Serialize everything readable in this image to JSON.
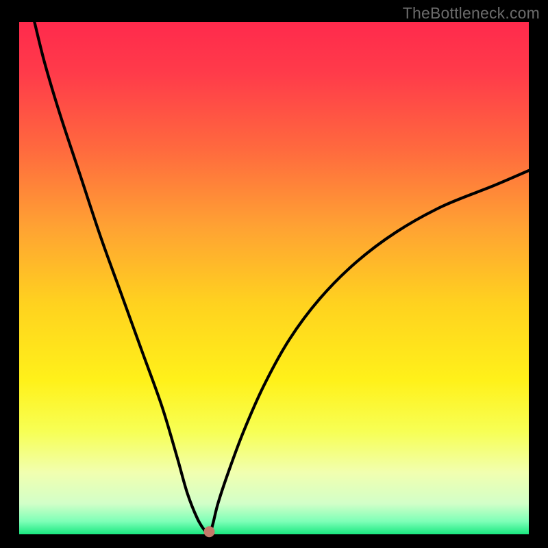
{
  "watermark": "TheBottleneck.com",
  "chart_data": {
    "type": "line",
    "title": "",
    "xlabel": "",
    "ylabel": "",
    "xlim": [
      0,
      100
    ],
    "ylim": [
      0,
      100
    ],
    "gradient_stops": [
      {
        "offset": 0.0,
        "color": "#ff2a4c"
      },
      {
        "offset": 0.1,
        "color": "#ff3b4a"
      },
      {
        "offset": 0.25,
        "color": "#ff6a3e"
      },
      {
        "offset": 0.4,
        "color": "#ffa233"
      },
      {
        "offset": 0.55,
        "color": "#ffd21f"
      },
      {
        "offset": 0.7,
        "color": "#fff11a"
      },
      {
        "offset": 0.8,
        "color": "#f7ff55"
      },
      {
        "offset": 0.88,
        "color": "#f1ffb0"
      },
      {
        "offset": 0.94,
        "color": "#d2ffc8"
      },
      {
        "offset": 0.975,
        "color": "#7dffb7"
      },
      {
        "offset": 1.0,
        "color": "#19e87f"
      }
    ],
    "series": [
      {
        "name": "bottleneck-curve",
        "x": [
          3,
          5,
          8,
          12,
          16,
          20,
          24,
          28,
          31,
          33,
          35,
          36.5,
          37.3,
          38,
          39,
          41,
          44,
          48,
          53,
          59,
          66,
          74,
          83,
          93,
          100
        ],
        "values": [
          100,
          92,
          82,
          70,
          58,
          47,
          36,
          25,
          15,
          8,
          3,
          0.6,
          0,
          2,
          6,
          12,
          20,
          29,
          38,
          46,
          53,
          59,
          64,
          68,
          71
        ]
      }
    ],
    "marker": {
      "x": 37.3,
      "y": 0.5,
      "color": "#c47a6a",
      "radius": 1.0
    },
    "frame": {
      "outer": {
        "x": 0,
        "y": 0,
        "w": 100,
        "h": 100,
        "color": "#000000"
      },
      "inner": {
        "x": 3.5,
        "y": 4.0,
        "w": 93,
        "h": 93.5
      }
    }
  }
}
